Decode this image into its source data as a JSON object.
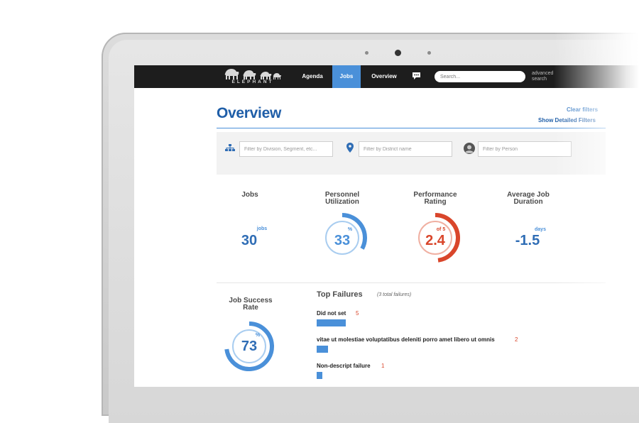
{
  "brand": {
    "logo_text": "ELEPHANT"
  },
  "nav": {
    "items": [
      {
        "label": "Agenda",
        "active": false
      },
      {
        "label": "Jobs",
        "active": true
      },
      {
        "label": "Overview",
        "active": false
      }
    ],
    "search_placeholder": "Search...",
    "advanced_search_line1": "advanced",
    "advanced_search_line2": "search"
  },
  "page": {
    "title": "Overview",
    "clear_filters": "Clear filters",
    "show_detailed_filters": "Show Detailed Filters"
  },
  "filters": {
    "division_placeholder": "Filter by Division, Segment, etc...",
    "district_placeholder": "Filter by District name",
    "person_placeholder": "Filter by Person"
  },
  "stats": {
    "jobs": {
      "label": "Jobs",
      "value": "30",
      "unit": "jobs"
    },
    "personnel": {
      "label_line1": "Personnel",
      "label_line2": "Utilization",
      "value": "33",
      "unit": "%",
      "fraction": 0.33
    },
    "performance": {
      "label_line1": "Performance",
      "label_line2": "Rating",
      "value": "2.4",
      "unit": "of 5",
      "fraction": 0.48
    },
    "avg_duration": {
      "label_line1": "Average Job",
      "label_line2": "Duration",
      "value": "-1.5",
      "unit": "days"
    }
  },
  "job_success": {
    "label_line1": "Job Success",
    "label_line2": "Rate",
    "value": "73",
    "unit": "%",
    "fraction": 0.73
  },
  "top_failures": {
    "title": "Top Failures",
    "subtitle": "(3 total failures)",
    "items": [
      {
        "label": "Did not set",
        "count": "5",
        "value": 5
      },
      {
        "label": "vitae ut molestiae voluptatibus deleniti porro amet libero ut omnis",
        "count": "2",
        "value": 2
      },
      {
        "label": "Non-descript failure",
        "count": "1",
        "value": 1
      }
    ]
  },
  "colors": {
    "blue": "#4a90d9",
    "blue_light": "#a9cdf0",
    "dark_blue": "#1f5ea8",
    "red": "#d9462b",
    "red_light": "#f0b0a2",
    "nav_bg": "#1d1d1d"
  }
}
